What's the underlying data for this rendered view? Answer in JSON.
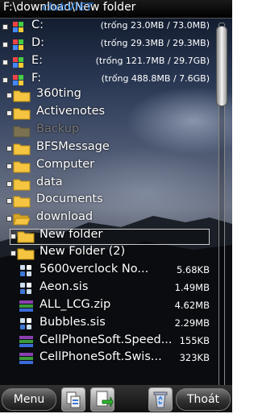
{
  "title": {
    "path": "F:\\download\\New folder",
    "watermark": "clubVIET"
  },
  "drives": [
    {
      "label": "C:",
      "info": "(trống 23.0MB / 73.0MB)"
    },
    {
      "label": "D:",
      "info": "(trống 29.3MB / 29.3MB)"
    },
    {
      "label": "E:",
      "info": "(trống 121.7MB / 29.7GB)"
    },
    {
      "label": "F:",
      "info": "(trống 488.8MB / 7.6GB)"
    }
  ],
  "folders": [
    {
      "name": "360ting"
    },
    {
      "name": "Activenotes"
    },
    {
      "name": "Backup"
    },
    {
      "name": "BFSMessage"
    },
    {
      "name": "Computer"
    },
    {
      "name": "data"
    },
    {
      "name": "Documents"
    },
    {
      "name": "download"
    }
  ],
  "subfolders": [
    {
      "name": "New folder"
    },
    {
      "name": "New Folder (2)"
    }
  ],
  "files": [
    {
      "name": "5600verclock No...",
      "size": "5.68KB",
      "icon": "sis-file-icon"
    },
    {
      "name": "Aeon.sis",
      "size": "1.49MB",
      "icon": "sis-file-icon"
    },
    {
      "name": "ALL_LCG.zip",
      "size": "4.62MB",
      "icon": "zip-file-icon"
    },
    {
      "name": "Bubbles.sis",
      "size": "2.29MB",
      "icon": "sis-file-icon"
    },
    {
      "name": "CellPhoneSoft.Speed...",
      "size": "155KB",
      "icon": "zip-file-icon"
    },
    {
      "name": "CellPhoneSoft.Swis...",
      "size": "323KB",
      "icon": "zip-file-icon"
    }
  ],
  "softkeys": {
    "left": "Menu",
    "right": "Thoát"
  },
  "colors": {
    "folder": "#f5c542",
    "selection_border": "#cccccc",
    "zip_purple": "#8a3fb0",
    "sis_blue": "#3a78d8"
  }
}
